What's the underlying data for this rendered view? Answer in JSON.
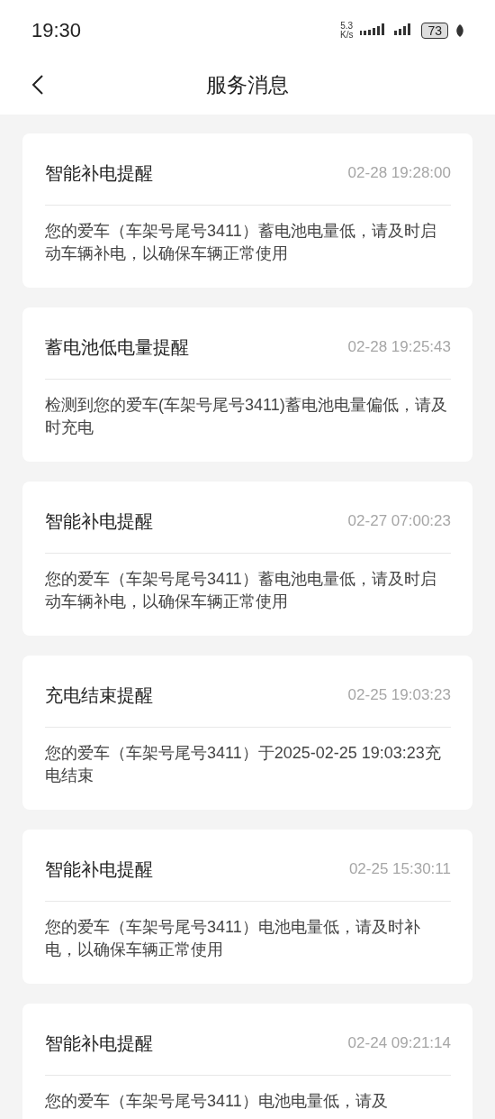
{
  "status_bar": {
    "time": "19:30",
    "speed_value": "5.3",
    "speed_unit": "K/s",
    "battery": "73"
  },
  "header": {
    "title": "服务消息"
  },
  "messages": [
    {
      "title": "智能补电提醒",
      "time": "02-28 19:28:00",
      "body": "您的爱车（车架号尾号3411）蓄电池电量低，请及时启动车辆补电，以确保车辆正常使用"
    },
    {
      "title": "蓄电池低电量提醒",
      "time": "02-28 19:25:43",
      "body": "检测到您的爱车(车架号尾号3411)蓄电池电量偏低，请及时充电"
    },
    {
      "title": "智能补电提醒",
      "time": "02-27 07:00:23",
      "body": "您的爱车（车架号尾号3411）蓄电池电量低，请及时启动车辆补电，以确保车辆正常使用"
    },
    {
      "title": "充电结束提醒",
      "time": "02-25 19:03:23",
      "body": "您的爱车（车架号尾号3411）于2025-02-25 19:03:23充电结束"
    },
    {
      "title": "智能补电提醒",
      "time": "02-25 15:30:11",
      "body": "您的爱车（车架号尾号3411）电池电量低，请及时补电，以确保车辆正常使用"
    },
    {
      "title": "智能补电提醒",
      "time": "02-24 09:21:14",
      "body": "您的爱车（车架号尾号3411）电池电量低，请及"
    }
  ]
}
